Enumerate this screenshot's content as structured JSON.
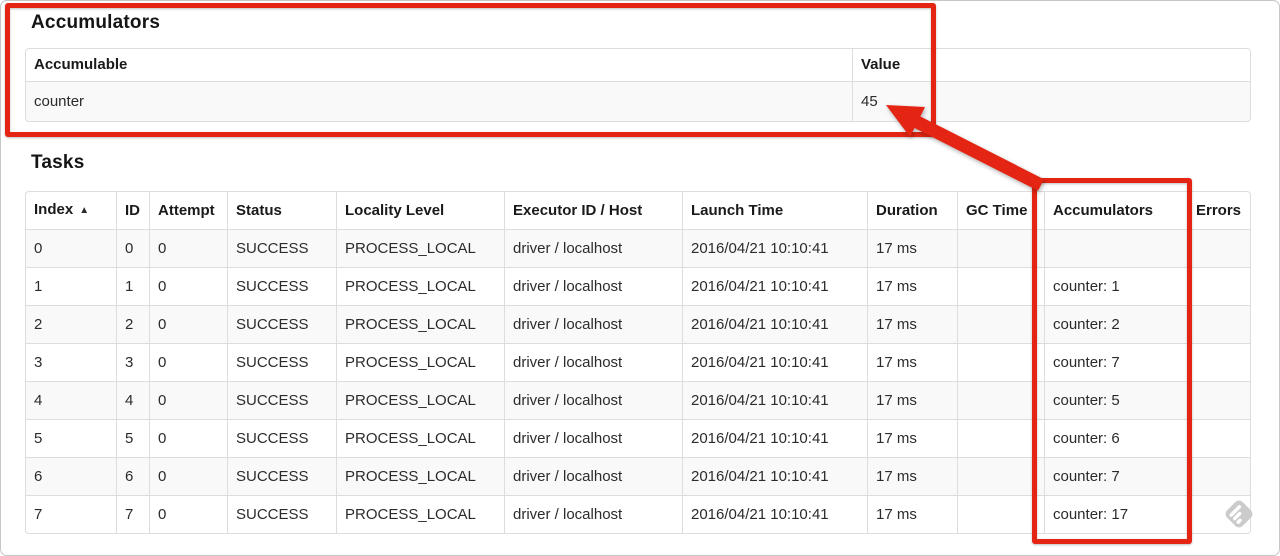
{
  "accumulators": {
    "heading": "Accumulators",
    "columns": [
      "Accumulable",
      "Value"
    ],
    "rows": [
      [
        "counter",
        "45"
      ]
    ]
  },
  "tasks": {
    "heading": "Tasks",
    "sort_icon": "▲",
    "columns": [
      "Index",
      "ID",
      "Attempt",
      "Status",
      "Locality Level",
      "Executor ID / Host",
      "Launch Time",
      "Duration",
      "GC Time",
      "Accumulators",
      "Errors"
    ],
    "rows": [
      [
        "0",
        "0",
        "0",
        "SUCCESS",
        "PROCESS_LOCAL",
        "driver / localhost",
        "2016/04/21 10:10:41",
        "17 ms",
        "",
        "",
        ""
      ],
      [
        "1",
        "1",
        "0",
        "SUCCESS",
        "PROCESS_LOCAL",
        "driver / localhost",
        "2016/04/21 10:10:41",
        "17 ms",
        "",
        "counter: 1",
        ""
      ],
      [
        "2",
        "2",
        "0",
        "SUCCESS",
        "PROCESS_LOCAL",
        "driver / localhost",
        "2016/04/21 10:10:41",
        "17 ms",
        "",
        "counter: 2",
        ""
      ],
      [
        "3",
        "3",
        "0",
        "SUCCESS",
        "PROCESS_LOCAL",
        "driver / localhost",
        "2016/04/21 10:10:41",
        "17 ms",
        "",
        "counter: 7",
        ""
      ],
      [
        "4",
        "4",
        "0",
        "SUCCESS",
        "PROCESS_LOCAL",
        "driver / localhost",
        "2016/04/21 10:10:41",
        "17 ms",
        "",
        "counter: 5",
        ""
      ],
      [
        "5",
        "5",
        "0",
        "SUCCESS",
        "PROCESS_LOCAL",
        "driver / localhost",
        "2016/04/21 10:10:41",
        "17 ms",
        "",
        "counter: 6",
        ""
      ],
      [
        "6",
        "6",
        "0",
        "SUCCESS",
        "PROCESS_LOCAL",
        "driver / localhost",
        "2016/04/21 10:10:41",
        "17 ms",
        "",
        "counter: 7",
        ""
      ],
      [
        "7",
        "7",
        "0",
        "SUCCESS",
        "PROCESS_LOCAL",
        "driver / localhost",
        "2016/04/21 10:10:41",
        "17 ms",
        "",
        "counter: 17",
        ""
      ]
    ]
  },
  "annotations": {
    "highlight_color": "#e42513",
    "annotated_value": "45",
    "annotated_column": "Accumulators"
  }
}
